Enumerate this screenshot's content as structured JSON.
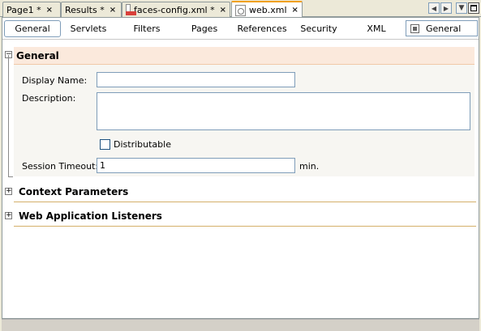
{
  "doc_tabs": [
    {
      "label": "Page1 *",
      "close": "×",
      "icon": ""
    },
    {
      "label": "Results *",
      "close": "×",
      "icon": ""
    },
    {
      "label": "faces-config.xml *",
      "close": "×",
      "icon": "jsf-config-file-icon"
    },
    {
      "label": "web.xml",
      "close": "×",
      "icon": "xml-file-icon"
    }
  ],
  "nav": {
    "left": "◀",
    "right": "▶",
    "dropdown": "▼"
  },
  "section_tabs": [
    "General",
    "Servlets",
    "Filters",
    "Pages",
    "References",
    "Security",
    "XML"
  ],
  "view_select": {
    "value": "General",
    "icon": "view-icon"
  },
  "general": {
    "title": "General",
    "expander": "−",
    "display_name_label": "Display Name:",
    "display_name_value": "",
    "description_label": "Description:",
    "description_value": "",
    "distributable_label": "Distributable",
    "distributable_checked": false,
    "session_timeout_label": "Session Timeout:",
    "session_timeout_value": "1",
    "session_timeout_unit": "min."
  },
  "collapsed_sections": [
    {
      "title": "Context Parameters",
      "expander": "+"
    },
    {
      "title": "Web Application Listeners",
      "expander": "+"
    }
  ],
  "colors": {
    "active_tab_accent": "#f0a020",
    "section_header_bg": "#fbe9dc",
    "section_rule": "#d4b06a"
  }
}
